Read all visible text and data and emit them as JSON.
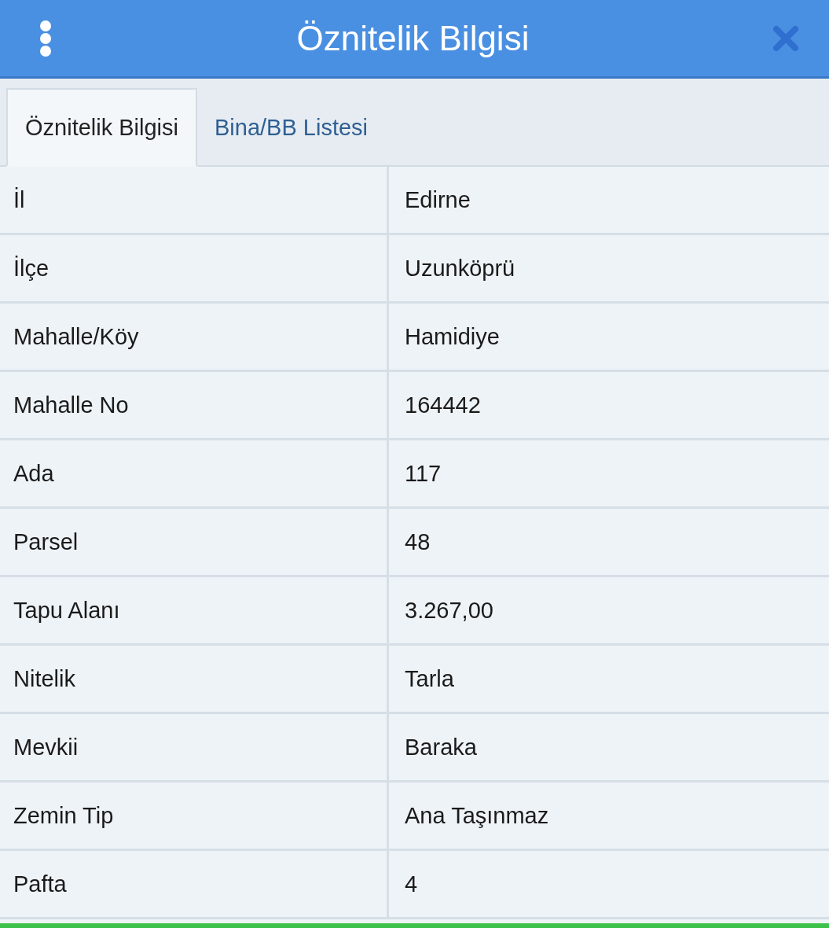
{
  "header": {
    "title": "Öznitelik Bilgisi"
  },
  "tabs": [
    {
      "label": "Öznitelik Bilgisi",
      "selected": true
    },
    {
      "label": "Bina/BB Listesi",
      "selected": false
    }
  ],
  "table": {
    "rows": [
      {
        "label": "İl",
        "value": "Edirne"
      },
      {
        "label": "İlçe",
        "value": "Uzunköprü"
      },
      {
        "label": "Mahalle/Köy",
        "value": "Hamidiye"
      },
      {
        "label": "Mahalle No",
        "value": "164442"
      },
      {
        "label": "Ada",
        "value": "117"
      },
      {
        "label": "Parsel",
        "value": "48"
      },
      {
        "label": "Tapu Alanı",
        "value": "3.267,00"
      },
      {
        "label": "Nitelik",
        "value": "Tarla"
      },
      {
        "label": "Mevkii",
        "value": "Baraka"
      },
      {
        "label": "Zemin Tip",
        "value": "Ana Taşınmaz"
      },
      {
        "label": "Pafta",
        "value": "4"
      }
    ]
  }
}
